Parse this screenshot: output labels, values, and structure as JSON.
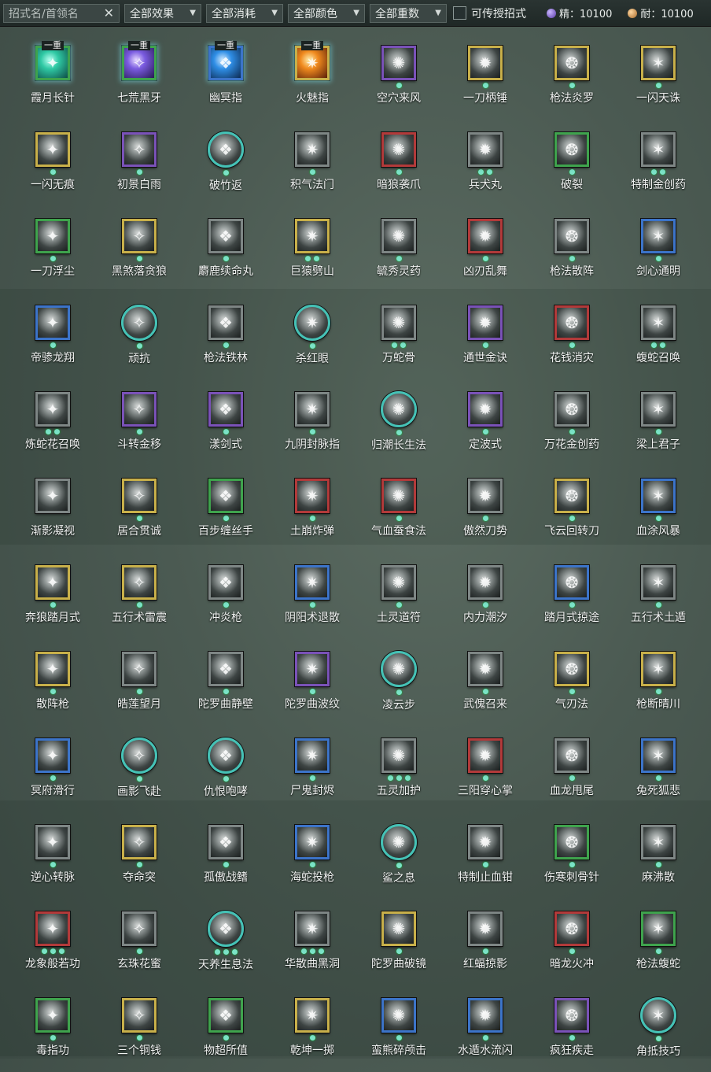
{
  "toolbar": {
    "search_placeholder": "招式名/首领名",
    "clear_icon": "close-icon",
    "filters": [
      "全部效果",
      "全部消耗",
      "全部颜色",
      "全部重数"
    ],
    "checkbox_label": "可传授招式",
    "checkbox_checked": false,
    "jing_label": "精：10100",
    "nai_label": "耐：10100"
  },
  "colors": {
    "gold": "#c8b04a",
    "green": "#3fa34d",
    "purple": "#7a52b8",
    "blue": "#3c74c9",
    "red": "#b23a3a",
    "gray": "#7e8685",
    "teal": "#45c2b6"
  },
  "skills": [
    {
      "name": "霞月长针",
      "frame": "green",
      "shape": "square",
      "dots": 0,
      "tier": "一重",
      "art": "cyan"
    },
    {
      "name": "七荒黑牙",
      "frame": "green",
      "shape": "square",
      "dots": 0,
      "tier": "一重",
      "art": "purple"
    },
    {
      "name": "幽冥指",
      "frame": "blue",
      "shape": "square",
      "dots": 0,
      "tier": "一重",
      "art": "blue"
    },
    {
      "name": "火魅指",
      "frame": "gold",
      "shape": "square",
      "dots": 0,
      "tier": "一重",
      "art": "fire"
    },
    {
      "name": "空穴来风",
      "frame": "purple",
      "shape": "square",
      "dots": 1
    },
    {
      "name": "一刀柄锤",
      "frame": "gold",
      "shape": "square",
      "dots": 1
    },
    {
      "name": "枪法炎罗",
      "frame": "gold",
      "shape": "square",
      "dots": 1
    },
    {
      "name": "一闪天诛",
      "frame": "gold",
      "shape": "square",
      "dots": 1
    },
    {
      "name": "一闪无痕",
      "frame": "gold",
      "shape": "square",
      "dots": 1
    },
    {
      "name": "初景白雨",
      "frame": "purple",
      "shape": "square",
      "dots": 1
    },
    {
      "name": "破竹返",
      "frame": "teal",
      "shape": "circle",
      "dots": 1
    },
    {
      "name": "积气法门",
      "frame": "gray",
      "shape": "square",
      "dots": 1
    },
    {
      "name": "暗狼袭爪",
      "frame": "red",
      "shape": "square",
      "dots": 1
    },
    {
      "name": "兵犬丸",
      "frame": "gray",
      "shape": "square",
      "dots": 2
    },
    {
      "name": "破裂",
      "frame": "green",
      "shape": "square",
      "dots": 1
    },
    {
      "name": "特制金创药",
      "frame": "gray",
      "shape": "square",
      "dots": 2
    },
    {
      "name": "一刀浮尘",
      "frame": "green",
      "shape": "square",
      "dots": 1
    },
    {
      "name": "黑煞落贪狼",
      "frame": "gold",
      "shape": "square",
      "dots": 1
    },
    {
      "name": "麝鹿续命丸",
      "frame": "gray",
      "shape": "square",
      "dots": 1
    },
    {
      "name": "巨猿劈山",
      "frame": "gold",
      "shape": "square",
      "dots": 2
    },
    {
      "name": "毓秀灵药",
      "frame": "gray",
      "shape": "square",
      "dots": 1
    },
    {
      "name": "凶刃乱舞",
      "frame": "red",
      "shape": "square",
      "dots": 1
    },
    {
      "name": "枪法散阵",
      "frame": "gray",
      "shape": "square",
      "dots": 1
    },
    {
      "name": "剑心通明",
      "frame": "blue",
      "shape": "square",
      "dots": 1
    },
    {
      "name": "帝骖龙翔",
      "frame": "blue",
      "shape": "square",
      "dots": 1
    },
    {
      "name": "顽抗",
      "frame": "teal",
      "shape": "circle",
      "dots": 1
    },
    {
      "name": "枪法铁林",
      "frame": "gray",
      "shape": "square",
      "dots": 1
    },
    {
      "name": "杀红眼",
      "frame": "teal",
      "shape": "circle",
      "dots": 1
    },
    {
      "name": "万蛇骨",
      "frame": "gray",
      "shape": "square",
      "dots": 2
    },
    {
      "name": "通世金诀",
      "frame": "purple",
      "shape": "square",
      "dots": 1
    },
    {
      "name": "花钱消灾",
      "frame": "red",
      "shape": "square",
      "dots": 1
    },
    {
      "name": "蝮蛇召唤",
      "frame": "gray",
      "shape": "square",
      "dots": 2
    },
    {
      "name": "炼蛇花召唤",
      "frame": "gray",
      "shape": "square",
      "dots": 2
    },
    {
      "name": "斗转金移",
      "frame": "purple",
      "shape": "square",
      "dots": 1
    },
    {
      "name": "漾剑式",
      "frame": "purple",
      "shape": "square",
      "dots": 1
    },
    {
      "name": "九阴封脉指",
      "frame": "gray",
      "shape": "square",
      "dots": 1
    },
    {
      "name": "归潮长生法",
      "frame": "teal",
      "shape": "circle",
      "dots": 1
    },
    {
      "name": "定波式",
      "frame": "purple",
      "shape": "square",
      "dots": 1
    },
    {
      "name": "万花金创药",
      "frame": "gray",
      "shape": "square",
      "dots": 1
    },
    {
      "name": "梁上君子",
      "frame": "gray",
      "shape": "square",
      "dots": 1
    },
    {
      "name": "渐影凝视",
      "frame": "gray",
      "shape": "square",
      "dots": 0
    },
    {
      "name": "居合贯诚",
      "frame": "gold",
      "shape": "square",
      "dots": 1
    },
    {
      "name": "百步缠丝手",
      "frame": "green",
      "shape": "square",
      "dots": 1
    },
    {
      "name": "土崩炸弹",
      "frame": "red",
      "shape": "square",
      "dots": 1
    },
    {
      "name": "气血蚕食法",
      "frame": "red",
      "shape": "square",
      "dots": 1
    },
    {
      "name": "傲然刀势",
      "frame": "gray",
      "shape": "square",
      "dots": 1
    },
    {
      "name": "飞云回转刀",
      "frame": "gold",
      "shape": "square",
      "dots": 1
    },
    {
      "name": "血涂风暴",
      "frame": "blue",
      "shape": "square",
      "dots": 1
    },
    {
      "name": "奔狼踏月式",
      "frame": "gold",
      "shape": "square",
      "dots": 1
    },
    {
      "name": "五行术雷震",
      "frame": "gold",
      "shape": "square",
      "dots": 1
    },
    {
      "name": "冲炎枪",
      "frame": "gray",
      "shape": "square",
      "dots": 1
    },
    {
      "name": "阴阳术退散",
      "frame": "blue",
      "shape": "square",
      "dots": 1
    },
    {
      "name": "土灵道符",
      "frame": "gray",
      "shape": "square",
      "dots": 1
    },
    {
      "name": "内力潮汐",
      "frame": "gray",
      "shape": "square",
      "dots": 1
    },
    {
      "name": "踏月式掠途",
      "frame": "blue",
      "shape": "square",
      "dots": 1
    },
    {
      "name": "五行术土遁",
      "frame": "gray",
      "shape": "square",
      "dots": 1
    },
    {
      "name": "散阵枪",
      "frame": "gold",
      "shape": "square",
      "dots": 1
    },
    {
      "name": "皓莲望月",
      "frame": "gray",
      "shape": "square",
      "dots": 1
    },
    {
      "name": "陀罗曲静壁",
      "frame": "gray",
      "shape": "square",
      "dots": 1
    },
    {
      "name": "陀罗曲波纹",
      "frame": "purple",
      "shape": "square",
      "dots": 1
    },
    {
      "name": "凌云步",
      "frame": "teal",
      "shape": "circle",
      "dots": 1
    },
    {
      "name": "武傀召来",
      "frame": "gray",
      "shape": "square",
      "dots": 1
    },
    {
      "name": "气刃法",
      "frame": "gold",
      "shape": "square",
      "dots": 1
    },
    {
      "name": "枪断晴川",
      "frame": "gold",
      "shape": "square",
      "dots": 1
    },
    {
      "name": "冥府滑行",
      "frame": "blue",
      "shape": "square",
      "dots": 1
    },
    {
      "name": "画影飞赴",
      "frame": "teal",
      "shape": "circle",
      "dots": 1
    },
    {
      "name": "仇恨咆哮",
      "frame": "teal",
      "shape": "circle",
      "dots": 1
    },
    {
      "name": "尸鬼封烬",
      "frame": "blue",
      "shape": "square",
      "dots": 1
    },
    {
      "name": "五灵加护",
      "frame": "gray",
      "shape": "square",
      "dots": 3
    },
    {
      "name": "三阳穿心掌",
      "frame": "red",
      "shape": "square",
      "dots": 1
    },
    {
      "name": "血龙甩尾",
      "frame": "gray",
      "shape": "square",
      "dots": 1
    },
    {
      "name": "兔死狐悲",
      "frame": "blue",
      "shape": "square",
      "dots": 1
    },
    {
      "name": "逆心转脉",
      "frame": "gray",
      "shape": "square",
      "dots": 1
    },
    {
      "name": "夺命突",
      "frame": "gold",
      "shape": "square",
      "dots": 1
    },
    {
      "name": "孤傲战鳍",
      "frame": "gray",
      "shape": "square",
      "dots": 1
    },
    {
      "name": "海蛇投枪",
      "frame": "blue",
      "shape": "square",
      "dots": 1
    },
    {
      "name": "鲨之息",
      "frame": "teal",
      "shape": "circle",
      "dots": 1
    },
    {
      "name": "特制止血钳",
      "frame": "gray",
      "shape": "square",
      "dots": 1
    },
    {
      "name": "伤寒刺骨针",
      "frame": "green",
      "shape": "square",
      "dots": 1
    },
    {
      "name": "麻沸散",
      "frame": "gray",
      "shape": "square",
      "dots": 1
    },
    {
      "name": "龙象般若功",
      "frame": "red",
      "shape": "square",
      "dots": 3
    },
    {
      "name": "玄珠花蜜",
      "frame": "gray",
      "shape": "square",
      "dots": 1
    },
    {
      "name": "天养生息法",
      "frame": "teal",
      "shape": "circle",
      "dots": 3
    },
    {
      "name": "华散曲黑洞",
      "frame": "gray",
      "shape": "square",
      "dots": 3
    },
    {
      "name": "陀罗曲破镜",
      "frame": "gold",
      "shape": "square",
      "dots": 1
    },
    {
      "name": "红蝠掠影",
      "frame": "gray",
      "shape": "square",
      "dots": 1
    },
    {
      "name": "暗龙火冲",
      "frame": "red",
      "shape": "square",
      "dots": 1
    },
    {
      "name": "枪法蝮蛇",
      "frame": "green",
      "shape": "square",
      "dots": 1
    },
    {
      "name": "毒指功",
      "frame": "green",
      "shape": "square",
      "dots": 1
    },
    {
      "name": "三个铜钱",
      "frame": "gold",
      "shape": "square",
      "dots": 1
    },
    {
      "name": "物超所值",
      "frame": "green",
      "shape": "square",
      "dots": 1
    },
    {
      "name": "乾坤一掷",
      "frame": "gold",
      "shape": "square",
      "dots": 1
    },
    {
      "name": "蛮熊碎颅击",
      "frame": "blue",
      "shape": "square",
      "dots": 1
    },
    {
      "name": "水遁水流闪",
      "frame": "blue",
      "shape": "square",
      "dots": 1
    },
    {
      "name": "疯狂疾走",
      "frame": "purple",
      "shape": "square",
      "dots": 1
    },
    {
      "name": "角抵技巧",
      "frame": "teal",
      "shape": "circle",
      "dots": 1
    }
  ]
}
